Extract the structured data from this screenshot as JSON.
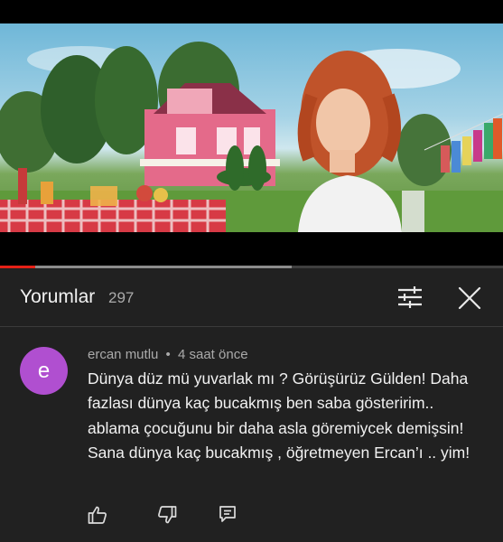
{
  "comments_header": {
    "title": "Yorumlar",
    "count": "297"
  },
  "video": {
    "progress_played": 0.07,
    "progress_buffered": 0.58
  },
  "comment": {
    "avatar_letter": "e",
    "avatar_color": "#b04fd0",
    "author": "ercan mutlu",
    "separator": "•",
    "time": "4 saat önce",
    "text": "Dünya düz mü yuvarlak mı ? Görüşürüz Gülden! Daha fazlası dünya kaç bucakmış ben saba gösteririm.. ablama çocuğunu bir daha asla göremiycek demişsin! Sana dünya kaç bucakmış , öğretmeyen Ercan’ı .. yim!"
  },
  "icons": {
    "filter": "sliders-icon",
    "close": "close-icon",
    "like": "thumbs-up-icon",
    "dislike": "thumbs-down-icon",
    "reply": "reply-comment-icon"
  }
}
